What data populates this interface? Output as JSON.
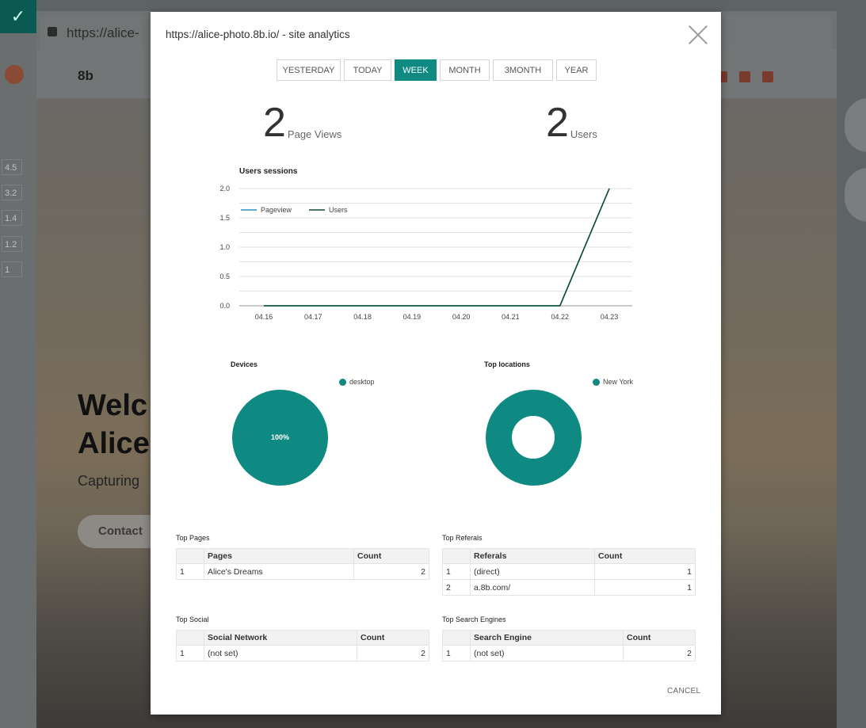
{
  "background": {
    "url": "https://alice-",
    "logo": "8b",
    "hero_title_line1": "Welc",
    "hero_title_line2": "Alice",
    "hero_subtitle": "Capturing",
    "contact_button": "Contact",
    "side_values": [
      "4.5",
      "3.2",
      "1.4",
      "1.2",
      "1"
    ]
  },
  "modal": {
    "title": "https://alice-photo.8b.io/ - site analytics",
    "tabs": [
      "YESTERDAY",
      "TODAY",
      "WEEK",
      "MONTH",
      "3MONTH",
      "YEAR"
    ],
    "active_tab": "WEEK",
    "page_views": {
      "value": "2",
      "label": "Page Views"
    },
    "users": {
      "value": "2",
      "label": "Users"
    },
    "cancel_label": "CANCEL"
  },
  "chart_data": [
    {
      "type": "line",
      "title": "Users sessions",
      "x": [
        "04.16",
        "04.17",
        "04.18",
        "04.19",
        "04.20",
        "04.21",
        "04.22",
        "04.23"
      ],
      "yticks": [
        "0.0",
        "0.5",
        "1.0",
        "1.5",
        "2.0"
      ],
      "ylim": [
        0,
        2
      ],
      "grid": true,
      "legend_position": "top-left",
      "series": [
        {
          "name": "Pageview",
          "color": "#2a8fbf",
          "values": [
            0,
            0,
            0,
            0,
            0,
            0,
            0,
            2
          ]
        },
        {
          "name": "Users",
          "color": "#0b4d2c",
          "values": [
            0,
            0,
            0,
            0,
            0,
            0,
            0,
            2
          ]
        }
      ]
    },
    {
      "type": "pie",
      "title": "Devices",
      "labels": [
        "desktop"
      ],
      "values": [
        100
      ],
      "data_label": "100%",
      "color": "#0e8a83"
    },
    {
      "type": "pie",
      "title": "Top locations",
      "labels": [
        "New York"
      ],
      "values": [
        100
      ],
      "color": "#0e8a83"
    }
  ],
  "tables": {
    "top_pages": {
      "title": "Top Pages",
      "headers": [
        "",
        "Pages",
        "Count"
      ],
      "rows": [
        [
          "1",
          "Alice's Dreams",
          "2"
        ]
      ]
    },
    "top_referals": {
      "title": "Top Referals",
      "headers": [
        "",
        "Referals",
        "Count"
      ],
      "rows": [
        [
          "1",
          "(direct)",
          "1"
        ],
        [
          "2",
          "a.8b.com/",
          "1"
        ]
      ]
    },
    "top_social": {
      "title": "Top Social",
      "headers": [
        "",
        "Social Network",
        "Count"
      ],
      "rows": [
        [
          "1",
          "(not set)",
          "2"
        ]
      ]
    },
    "top_search": {
      "title": "Top Search Engines",
      "headers": [
        "",
        "Search Engine",
        "Count"
      ],
      "rows": [
        [
          "1",
          "(not set)",
          "2"
        ]
      ]
    }
  }
}
